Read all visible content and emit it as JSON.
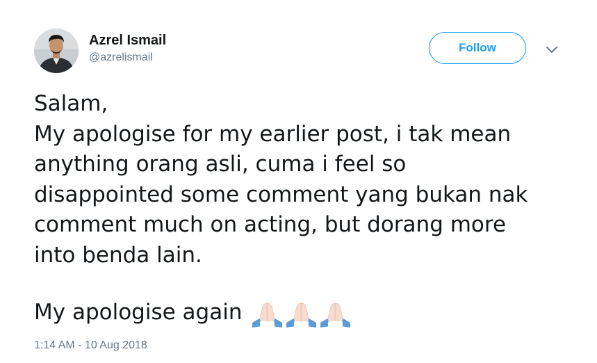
{
  "author": {
    "display_name": "Azrel Ismail",
    "screen_name": "@azrelismail"
  },
  "actions": {
    "follow_label": "Follow",
    "more_icon": "chevron-down-icon"
  },
  "tweet": {
    "lines": [
      "Salam,",
      "My apologise for my earlier post, i tak mean",
      "anything orang asli, cuma i feel so",
      "disappointed some comment yang bukan nak",
      "comment much on acting, but dorang more",
      "into benda lain."
    ],
    "closing_text": "My apologise again",
    "emoji": [
      "praying-hands-icon",
      "praying-hands-icon",
      "praying-hands-icon"
    ]
  },
  "meta": {
    "timestamp": "1:14 AM - 10 Aug 2018"
  },
  "colors": {
    "text": "#14171a",
    "secondary": "#657786",
    "accent": "#1da1f2"
  }
}
